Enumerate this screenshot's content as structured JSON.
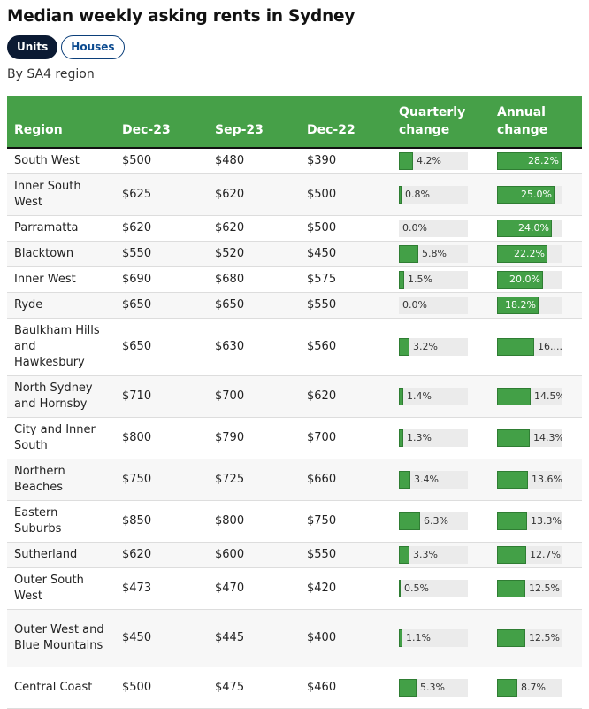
{
  "title": "Median weekly asking rents in Sydney",
  "toggles": [
    {
      "label": "Units",
      "active": true
    },
    {
      "label": "Houses",
      "active": false
    }
  ],
  "subtitle": "By SA4 region",
  "colors": {
    "header_bg": "#46a048",
    "bar_fill": "#43a047",
    "bar_track": "#ebebeb",
    "toggle_active": "#0b1a33",
    "toggle_inactive_text": "#0b4a8f"
  },
  "table": {
    "columns": [
      "Region",
      "Dec-23",
      "Sep-23",
      "Dec-22",
      "Quarterly change",
      "Annual change"
    ],
    "bar_scale": {
      "quarterly_max": 28.2,
      "annual_max": 28.2
    },
    "rows": [
      {
        "region": "South West",
        "dec23": "$500",
        "sep23": "$480",
        "dec22": "$390",
        "quarterly": 4.2,
        "quarterly_label": "4.2%",
        "annual": 28.2,
        "annual_label": "28.2%"
      },
      {
        "region": "Inner South West",
        "dec23": "$625",
        "sep23": "$620",
        "dec22": "$500",
        "quarterly": 0.8,
        "quarterly_label": "0.8%",
        "annual": 25.0,
        "annual_label": "25.0%"
      },
      {
        "region": "Parramatta",
        "dec23": "$620",
        "sep23": "$620",
        "dec22": "$500",
        "quarterly": 0.0,
        "quarterly_label": "0.0%",
        "annual": 24.0,
        "annual_label": "24.0%"
      },
      {
        "region": "Blacktown",
        "dec23": "$550",
        "sep23": "$520",
        "dec22": "$450",
        "quarterly": 5.8,
        "quarterly_label": "5.8%",
        "annual": 22.2,
        "annual_label": "22.2%"
      },
      {
        "region": "Inner West",
        "dec23": "$690",
        "sep23": "$680",
        "dec22": "$575",
        "quarterly": 1.5,
        "quarterly_label": "1.5%",
        "annual": 20.0,
        "annual_label": "20.0%"
      },
      {
        "region": "Ryde",
        "dec23": "$650",
        "sep23": "$650",
        "dec22": "$550",
        "quarterly": 0.0,
        "quarterly_label": "0.0%",
        "annual": 18.2,
        "annual_label": "18.2%"
      },
      {
        "region": "Baulkham Hills and Hawkesbury",
        "dec23": "$650",
        "sep23": "$630",
        "dec22": "$560",
        "quarterly": 3.2,
        "quarterly_label": "3.2%",
        "annual": 16.1,
        "annual_label": "16...."
      },
      {
        "region": "North Sydney and Hornsby",
        "dec23": "$710",
        "sep23": "$700",
        "dec22": "$620",
        "quarterly": 1.4,
        "quarterly_label": "1.4%",
        "annual": 14.5,
        "annual_label": "14.5%"
      },
      {
        "region": "City and Inner South",
        "dec23": "$800",
        "sep23": "$790",
        "dec22": "$700",
        "quarterly": 1.3,
        "quarterly_label": "1.3%",
        "annual": 14.3,
        "annual_label": "14.3%"
      },
      {
        "region": "Northern Beaches",
        "dec23": "$750",
        "sep23": "$725",
        "dec22": "$660",
        "quarterly": 3.4,
        "quarterly_label": "3.4%",
        "annual": 13.6,
        "annual_label": "13.6%"
      },
      {
        "region": "Eastern Suburbs",
        "dec23": "$850",
        "sep23": "$800",
        "dec22": "$750",
        "quarterly": 6.3,
        "quarterly_label": "6.3%",
        "annual": 13.3,
        "annual_label": "13.3%"
      },
      {
        "region": "Sutherland",
        "dec23": "$620",
        "sep23": "$600",
        "dec22": "$550",
        "quarterly": 3.3,
        "quarterly_label": "3.3%",
        "annual": 12.7,
        "annual_label": "12.7%"
      },
      {
        "region": "Outer South West",
        "dec23": "$473",
        "sep23": "$470",
        "dec22": "$420",
        "quarterly": 0.5,
        "quarterly_label": "0.5%",
        "annual": 12.5,
        "annual_label": "12.5%"
      },
      {
        "region": "Outer West and Blue Mountains",
        "dec23": "$450",
        "sep23": "$445",
        "dec22": "$400",
        "quarterly": 1.1,
        "quarterly_label": "1.1%",
        "annual": 12.5,
        "annual_label": "12.5%"
      },
      {
        "region": "Central Coast",
        "dec23": "$500",
        "sep23": "$475",
        "dec22": "$460",
        "quarterly": 5.3,
        "quarterly_label": "5.3%",
        "annual": 8.7,
        "annual_label": "8.7%"
      }
    ]
  }
}
